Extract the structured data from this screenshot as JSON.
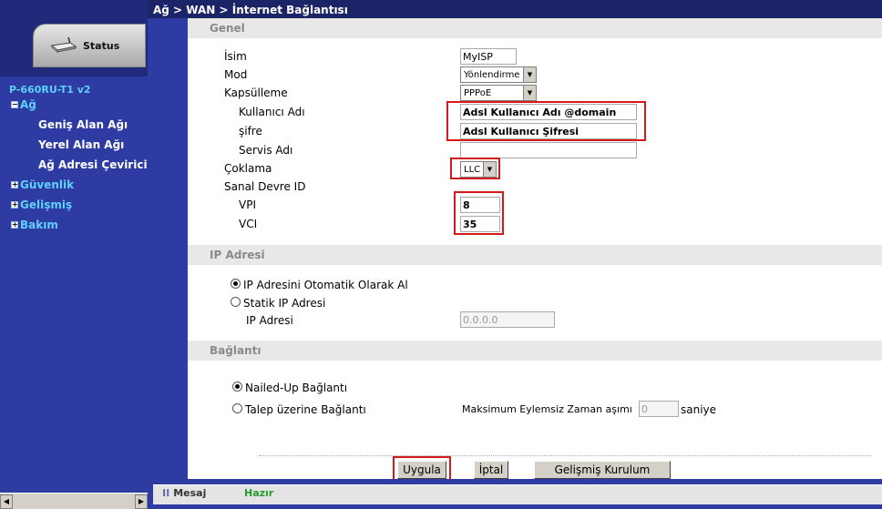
{
  "breadcrumb": "Ağ > WAN > İnternet Bağlantısı",
  "sidebar": {
    "status_tab": "Status",
    "device": "P-660RU-T1 v2",
    "ag": "Ağ",
    "genis": "Geniş Alan Ağı",
    "yerel": "Yerel Alan Ağı",
    "adres": "Ağ Adresi Çeviricis",
    "guvenlik": "Güvenlik",
    "gelismis": "Gelişmiş",
    "bakim": "Bakım"
  },
  "genel": {
    "title": "Genel",
    "isim_label": "İsim",
    "isim_value": "MyISP",
    "mod_label": "Mod",
    "mod_value": "Yönlendirme",
    "kapsulleme_label": "Kapsülleme",
    "kapsulleme_value": "PPPoE",
    "kullanici_label": "Kullanıcı Adı",
    "kullanici_value": "Adsl Kullanıcı Adı @domain",
    "sifre_label": "şifre",
    "sifre_value": "Adsl Kullanıcı Şifresi",
    "servis_label": "Servis Adı",
    "servis_value": "",
    "coklama_label": "Çoklama",
    "coklama_value": "LLC",
    "sanal_label": "Sanal Devre ID",
    "vpi_label": "VPI",
    "vpi_value": "8",
    "vci_label": "VCI",
    "vci_value": "35"
  },
  "ip": {
    "title": "IP Adresi",
    "auto_label": "IP Adresini Otomatik Olarak Al",
    "static_label": "Statik IP Adresi",
    "addr_label": "IP Adresi",
    "addr_value": "0.0.0.0"
  },
  "baglanti": {
    "title": "Bağlantı",
    "nailed_label": "Nailed-Up Bağlantı",
    "talep_label": "Talep üzerine Bağlantı",
    "maks_label": "Maksimum Eylemsiz Zaman aşımı",
    "maks_value": "0",
    "saniye": "saniye"
  },
  "buttons": {
    "uygula": "Uygula",
    "iptal": "İptal",
    "gelismis": "Gelişmiş Kurulum"
  },
  "statusbar": {
    "mesaj": "Mesaj",
    "status": "Hazır"
  }
}
